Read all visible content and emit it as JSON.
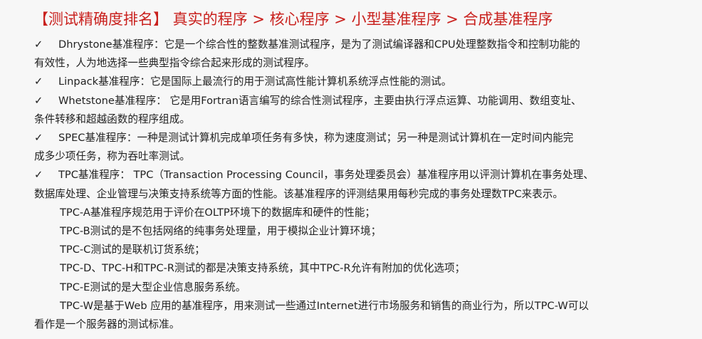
{
  "title": "【测试精确度排名】 真实的程序 > 核心程序 > 小型基准程序 > 合成基准程序",
  "check_mark": "✓",
  "items": [
    {
      "line1": "Dhrystone基准程序：它是一个综合性的整数基准测试程序，是为了测试编译器和CPU处理整数指令和控制功能的",
      "line2": "有效性，人为地选择一些典型指令综合起来形成的测试程序。"
    },
    {
      "line1": "Linpack基准程序：它是国际上最流行的用于测试高性能计算机系统浮点性能的测试。",
      "line2": ""
    },
    {
      "line1": "Whetstone基准程序：  它是用Fortran语言编写的综合性测试程序，主要由执行浮点运算、功能调用、数组变址、",
      "line2": "条件转移和超越函数的程序组成。"
    },
    {
      "line1": "SPEC基准程序：一种是测试计算机完成单项任务有多快，称为速度测试；另一种是测试计算机在一定时间内能完",
      "line2": "成多少项任务，称为吞吐率测试。"
    },
    {
      "line1": "TPC基准程序：  TPC（Transaction Processing Council，事务处理委员会）基准程序用以评测计算机在事务处理、",
      "line2": "数据库处理、企业管理与决策支持系统等方面的性能。该基准程序的评测结果用每秒完成的事务处理数TPC来表示。"
    }
  ],
  "sub_items": [
    "TPC-A基准程序规范用于评价在OLTP环境下的数据库和硬件的性能；",
    "TPC-B测试的是不包括网络的纯事务处理量，用于模拟企业计算环境；",
    "TPC-C测试的是联机订货系统；",
    "TPC-D、TPC-H和TPC-R测试的都是决策支持系统，其中TPC-R允许有附加的优化选项；",
    "TPC-E测试的是大型企业信息服务系统。"
  ],
  "tail": {
    "line1": "TPC-W是基于Web 应用的基准程序，用来测试一些通过Internet进行市场服务和销售的商业行为，所以TPC-W可以",
    "line2": "看作是一个服务器的测试标准。"
  }
}
